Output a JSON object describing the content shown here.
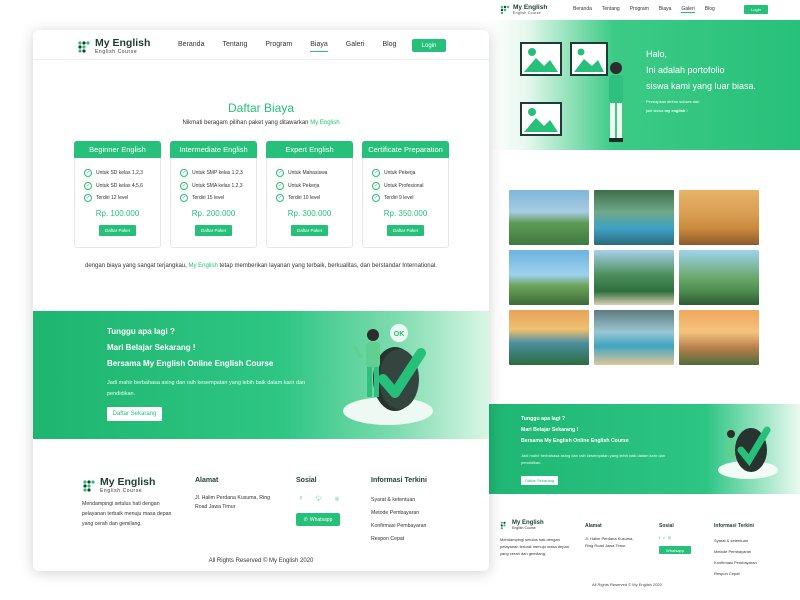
{
  "colors": {
    "accent": "#27c07a",
    "dark": "#1b3d33"
  },
  "brand": {
    "name": "My English",
    "tagline": "English Course"
  },
  "nav": {
    "items": [
      "Beranda",
      "Tentang",
      "Program",
      "Biaya",
      "Galeri",
      "Blog"
    ],
    "active": "Biaya",
    "login": "Login"
  },
  "pricing": {
    "title": "Daftar Biaya",
    "subtitle_prefix": "Nikmati beragam pilihan paket yang ditawarkan",
    "subtitle_brand": "My English",
    "plans": [
      {
        "name": "Beginner English",
        "features": [
          "Untuk SD kelas 1,2,3",
          "Untuk SD kelas 4,5,6",
          "Terdiri 12 level"
        ],
        "price": "Rp. 100.000",
        "button": "Daftar Paket"
      },
      {
        "name": "Intermediate English",
        "features": [
          "Untuk SMP kelas 1,2,3",
          "Untuk SMA kelas 1,2,3",
          "Terdiri 15 level"
        ],
        "price": "Rp. 200.000",
        "button": "Daftar Paket"
      },
      {
        "name": "Expert English",
        "features": [
          "Untuk Mahasiswa",
          "Untuk Pekerja",
          "Terdiri 10 level"
        ],
        "price": "Rp. 300.000",
        "button": "Daftar Paket"
      },
      {
        "name": "Certificate Preparation",
        "features": [
          "Untuk Pekerja",
          "Untuk Profesional",
          "Terdiri 9 level"
        ],
        "price": "Rp. 350.000",
        "button": "Daftar Paket"
      }
    ],
    "tagline_prefix": "dengan biaya yang sangat terjangkau,",
    "tagline_brand": "My English",
    "tagline_suffix": "tetap memberikan layanan yang terbaik, berkualitas, dan berstandar International."
  },
  "cta": {
    "line1": "Tunggu apa lagi ?",
    "line2": "Mari Belajar Sekarang !",
    "line3": "Bersama My English Online English Course",
    "desc": "Jadi mahir berbahasa asing dan raih kesempatan yang lebih baik dalam karir dan pendidikan.",
    "button": "Daftar Sekarang",
    "badge": "OK"
  },
  "footer": {
    "desc": "Mendampingi setulus hati dengan pelayanan terbaik menuju masa depan yang cerah dan gemilang.",
    "address_title": "Alamat",
    "address": "Jl. Halim Perdana Kusuma, Ring Road Jawa Timur",
    "social_title": "Sosial",
    "social_icons": [
      "facebook-icon",
      "twitter-icon",
      "instagram-icon"
    ],
    "whatsapp": "Whatsapp",
    "info_title": "Informasi Terkini",
    "info_links": [
      "Syarat & ketentuan",
      "Metode Pembayaran",
      "Konfirmasi Pembayaran",
      "Respon Cepat"
    ],
    "copyright": "All Rights Reserved © My English 2020"
  },
  "gallery_page": {
    "nav_active": "Galeri",
    "hero_lines": [
      "Halo,",
      "Ini adalah portofolio",
      "siswa kami yang luar biasa."
    ],
    "hero_sub_line1": "Persiapkan dirimu sukses dan",
    "hero_sub_line2_prefix": "jadi siswa",
    "hero_sub_line2_brand": "my english",
    "hero_sub_line2_suffix": "!",
    "cta_desc": "Jadi mahir berbahasa asing dan raih kesempatan yang lebih baik dalam karir dan pendidikan.",
    "tiles": 9
  }
}
